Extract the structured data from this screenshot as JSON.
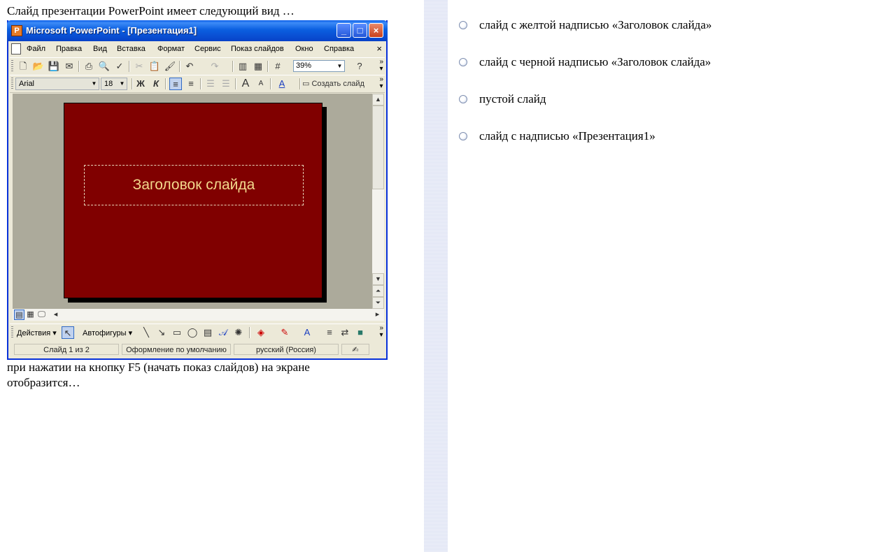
{
  "question": {
    "intro": "Слайд презентации PowerPoint имеет следующий вид …",
    "outro": "при нажатии на кнопку F5 (начать показ слайдов) на экране отобразится…"
  },
  "screenshot": {
    "window_title": "Microsoft PowerPoint - [Презентация1]",
    "menu": [
      "Файл",
      "Правка",
      "Вид",
      "Вставка",
      "Формат",
      "Сервис",
      "Показ слайдов",
      "Окно",
      "Справка"
    ],
    "zoom": "39%",
    "font_name": "Arial",
    "font_size": "18",
    "bold_label": "Ж",
    "italic_label": "К",
    "new_slide_label": "Создать слайд",
    "slide_title": "Заголовок слайда",
    "slide_background_color": "#800000",
    "slide_title_color": "#f3d98d",
    "draw_actions_label": "Действия",
    "autoshapes_label": "Автофигуры",
    "status": {
      "slide": "Слайд 1 из 2",
      "design": "Оформление по умолчанию",
      "language": "русский (Россия)"
    }
  },
  "answers": [
    {
      "label": "слайд с желтой надписью «Заголовок слайда»",
      "selected": false
    },
    {
      "label": "слайд с черной надписью «Заголовок слайда»",
      "selected": false
    },
    {
      "label": "пустой слайд",
      "selected": false
    },
    {
      "label": "слайд с надписью «Презентация1»",
      "selected": false
    }
  ]
}
